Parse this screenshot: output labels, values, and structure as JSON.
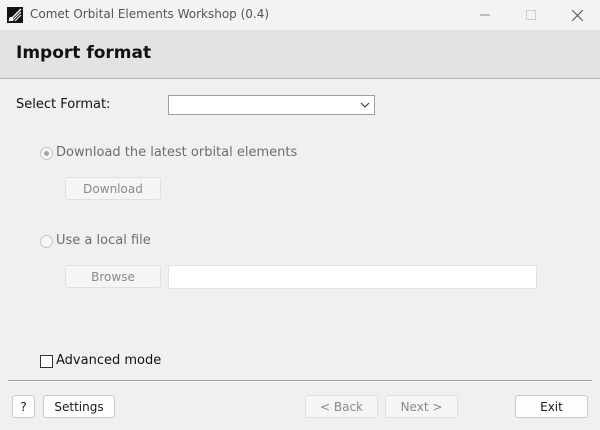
{
  "window": {
    "title": "Comet Orbital Elements Workshop (0.4)",
    "app_icon": "comet-app-icon",
    "controls": [
      "minimize-icon",
      "maximize-icon",
      "close-icon"
    ]
  },
  "header": {
    "title": "Import format"
  },
  "format": {
    "label": "Select Format:",
    "selected": "",
    "arrow_icon": "chevron-down-icon"
  },
  "download_option": {
    "label": "Download the latest orbital elements",
    "selected": true,
    "enabled": false,
    "button_label": "Download"
  },
  "local_option": {
    "label": "Use a local file",
    "selected": false,
    "enabled": false,
    "browse_label": "Browse",
    "path_value": ""
  },
  "advanced": {
    "label": "Advanced mode",
    "checked": false
  },
  "footer": {
    "help_label": "?",
    "settings_label": "Settings",
    "back_label": "< Back",
    "next_label": "Next >",
    "exit_label": "Exit"
  },
  "colors": {
    "window_bg": "#f0f0f0",
    "header_bg": "#e3e3e3",
    "disabled_text": "#6d6d6d"
  }
}
